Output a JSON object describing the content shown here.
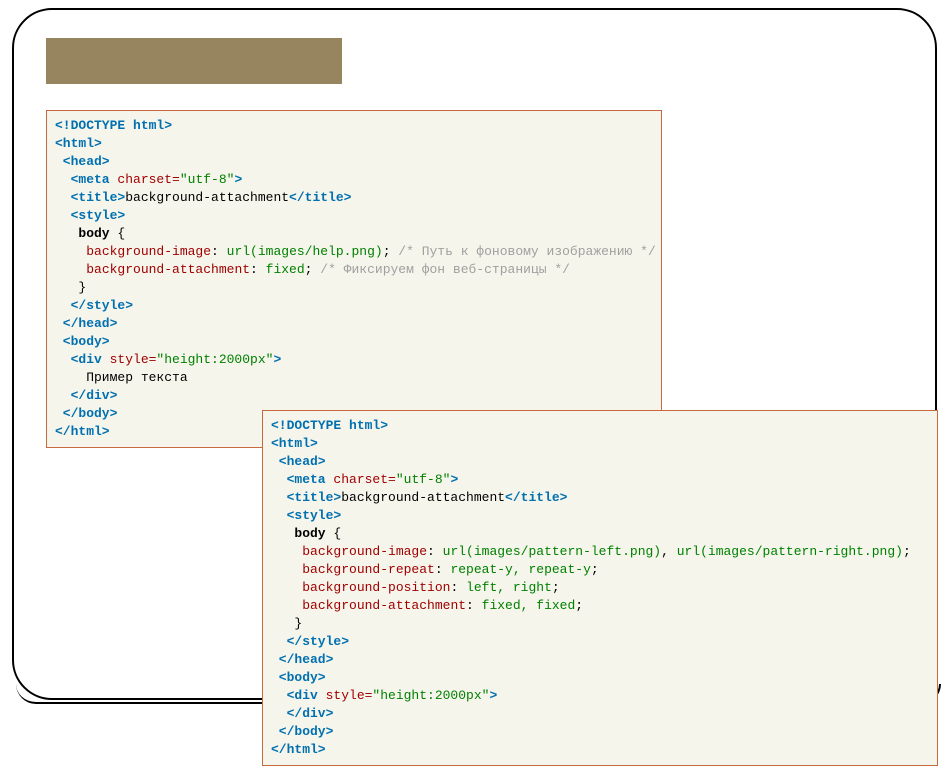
{
  "title_bar_label": "",
  "code_block_1": {
    "lines": [
      [
        {
          "c": "tg",
          "t": "<!DOCTYPE html>"
        }
      ],
      [
        {
          "c": "tg",
          "t": "<html>"
        }
      ],
      [
        {
          "c": "tg",
          "t": " <head>"
        }
      ],
      [
        {
          "c": "tg",
          "t": "  <meta "
        },
        {
          "c": "at",
          "t": "charset="
        },
        {
          "c": "vl",
          "t": "\"utf-8\""
        },
        {
          "c": "tg",
          "t": ">"
        }
      ],
      [
        {
          "c": "tg",
          "t": "  <title>"
        },
        {
          "c": "tx",
          "t": "background-attachment"
        },
        {
          "c": "tg",
          "t": "</title>"
        }
      ],
      [
        {
          "c": "tg",
          "t": "  <style>"
        }
      ],
      [
        {
          "c": "kw",
          "t": "   body"
        },
        {
          "c": "tx",
          "t": " {"
        }
      ],
      [
        {
          "c": "tx",
          "t": "    "
        },
        {
          "c": "pr",
          "t": "background-image"
        },
        {
          "c": "tx",
          "t": ": "
        },
        {
          "c": "pv",
          "t": "url(images/help.png)"
        },
        {
          "c": "tx",
          "t": "; "
        },
        {
          "c": "cm",
          "t": "/* Путь к фоновому изображению */"
        }
      ],
      [
        {
          "c": "tx",
          "t": "    "
        },
        {
          "c": "pr",
          "t": "background-attachment"
        },
        {
          "c": "tx",
          "t": ": "
        },
        {
          "c": "pv",
          "t": "fixed"
        },
        {
          "c": "tx",
          "t": "; "
        },
        {
          "c": "cm",
          "t": "/* Фиксируем фон веб-страницы */"
        }
      ],
      [
        {
          "c": "tx",
          "t": "   }"
        }
      ],
      [
        {
          "c": "tg",
          "t": "  </style>"
        }
      ],
      [
        {
          "c": "tg",
          "t": " </head>"
        }
      ],
      [
        {
          "c": "tg",
          "t": " <body>"
        }
      ],
      [
        {
          "c": "tg",
          "t": "  <div "
        },
        {
          "c": "at",
          "t": "style="
        },
        {
          "c": "vl",
          "t": "\"height:2000px\""
        },
        {
          "c": "tg",
          "t": ">"
        }
      ],
      [
        {
          "c": "tx",
          "t": "    Пример текста"
        }
      ],
      [
        {
          "c": "tg",
          "t": "  </div>"
        }
      ],
      [
        {
          "c": "tg",
          "t": " </body>"
        }
      ],
      [
        {
          "c": "tg",
          "t": "</html>"
        }
      ]
    ]
  },
  "code_block_2": {
    "lines": [
      [
        {
          "c": "tg",
          "t": "<!DOCTYPE html>"
        }
      ],
      [
        {
          "c": "tg",
          "t": "<html>"
        }
      ],
      [
        {
          "c": "tg",
          "t": " <head>"
        }
      ],
      [
        {
          "c": "tg",
          "t": "  <meta "
        },
        {
          "c": "at",
          "t": "charset="
        },
        {
          "c": "vl",
          "t": "\"utf-8\""
        },
        {
          "c": "tg",
          "t": ">"
        }
      ],
      [
        {
          "c": "tg",
          "t": "  <title>"
        },
        {
          "c": "tx",
          "t": "background-attachment"
        },
        {
          "c": "tg",
          "t": "</title>"
        }
      ],
      [
        {
          "c": "tg",
          "t": "  <style>"
        }
      ],
      [
        {
          "c": "kw",
          "t": "   body"
        },
        {
          "c": "tx",
          "t": " {"
        }
      ],
      [
        {
          "c": "tx",
          "t": "    "
        },
        {
          "c": "pr",
          "t": "background-image"
        },
        {
          "c": "tx",
          "t": ": "
        },
        {
          "c": "pv",
          "t": "url(images/pattern-left.png)"
        },
        {
          "c": "tx",
          "t": ", "
        },
        {
          "c": "pv",
          "t": "url(images/pattern-right.png)"
        },
        {
          "c": "tx",
          "t": ";"
        }
      ],
      [
        {
          "c": "tx",
          "t": "    "
        },
        {
          "c": "pr",
          "t": "background-repeat"
        },
        {
          "c": "tx",
          "t": ": "
        },
        {
          "c": "pv",
          "t": "repeat-y, repeat-y"
        },
        {
          "c": "tx",
          "t": ";"
        }
      ],
      [
        {
          "c": "tx",
          "t": "    "
        },
        {
          "c": "pr",
          "t": "background-position"
        },
        {
          "c": "tx",
          "t": ": "
        },
        {
          "c": "pv",
          "t": "left, right"
        },
        {
          "c": "tx",
          "t": ";"
        }
      ],
      [
        {
          "c": "tx",
          "t": "    "
        },
        {
          "c": "pr",
          "t": "background-attachment"
        },
        {
          "c": "tx",
          "t": ": "
        },
        {
          "c": "pv",
          "t": "fixed, fixed"
        },
        {
          "c": "tx",
          "t": ";"
        }
      ],
      [
        {
          "c": "tx",
          "t": "   }"
        }
      ],
      [
        {
          "c": "tg",
          "t": "  </style>"
        }
      ],
      [
        {
          "c": "tg",
          "t": " </head>"
        }
      ],
      [
        {
          "c": "tg",
          "t": " <body>"
        }
      ],
      [
        {
          "c": "tg",
          "t": "  <div "
        },
        {
          "c": "at",
          "t": "style="
        },
        {
          "c": "vl",
          "t": "\"height:2000px\""
        },
        {
          "c": "tg",
          "t": ">"
        }
      ],
      [
        {
          "c": "tg",
          "t": "  </div>"
        }
      ],
      [
        {
          "c": "tg",
          "t": " </body>"
        }
      ],
      [
        {
          "c": "tg",
          "t": "</html>"
        }
      ]
    ]
  }
}
